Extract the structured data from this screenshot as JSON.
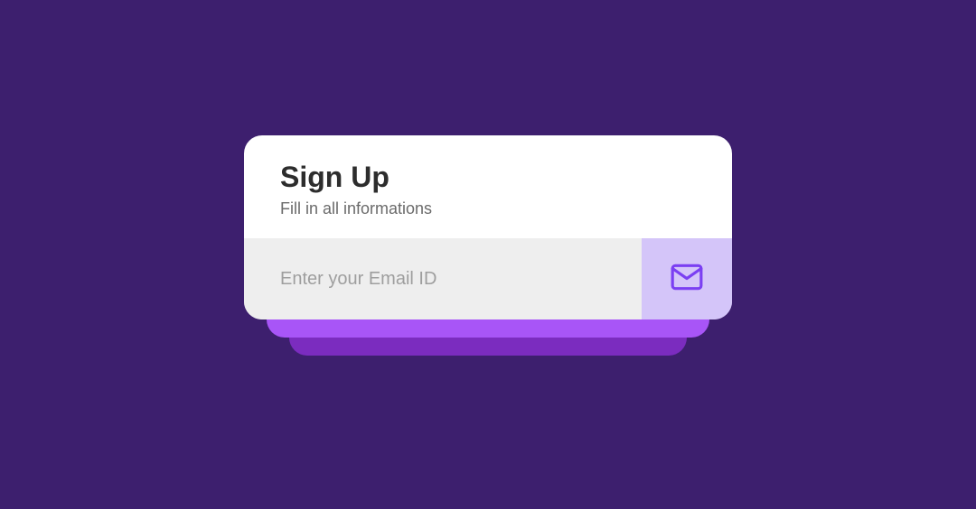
{
  "form": {
    "title": "Sign Up",
    "subtitle": "Fill in all informations",
    "email_placeholder": "Enter your Email ID"
  },
  "colors": {
    "background": "#3d1f6e",
    "accent": "#7b3ff2",
    "shadow1": "#a855f7",
    "shadow2": "#7b2cbf"
  }
}
